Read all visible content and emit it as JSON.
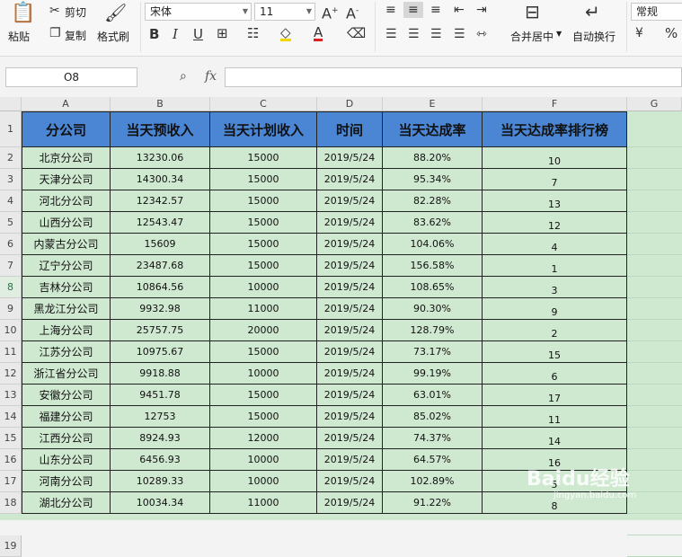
{
  "ribbon": {
    "paste": "粘贴",
    "cut": "剪切",
    "copy": "复制",
    "format_painter": "格式刷",
    "font_name": "宋体",
    "font_size": "11",
    "merge_center": "合并居中",
    "wrap_text": "自动换行",
    "number_format": "常规"
  },
  "formula_bar": {
    "cell_ref": "O8",
    "fx_label": "fx",
    "content": ""
  },
  "columns": [
    "A",
    "B",
    "C",
    "D",
    "E",
    "F",
    "G"
  ],
  "headers": [
    "分公司",
    "当天预收入",
    "当天计划收入",
    "时间",
    "当天达成率",
    "当天达成率排行榜"
  ],
  "rows": [
    [
      "北京分公司",
      "13230.06",
      "15000",
      "2019/5/24",
      "88.20%",
      "10"
    ],
    [
      "天津分公司",
      "14300.34",
      "15000",
      "2019/5/24",
      "95.34%",
      "7"
    ],
    [
      "河北分公司",
      "12342.57",
      "15000",
      "2019/5/24",
      "82.28%",
      "13"
    ],
    [
      "山西分公司",
      "12543.47",
      "15000",
      "2019/5/24",
      "83.62%",
      "12"
    ],
    [
      "内蒙古分公司",
      "15609",
      "15000",
      "2019/5/24",
      "104.06%",
      "4"
    ],
    [
      "辽宁分公司",
      "23487.68",
      "15000",
      "2019/5/24",
      "156.58%",
      "1"
    ],
    [
      "吉林分公司",
      "10864.56",
      "10000",
      "2019/5/24",
      "108.65%",
      "3"
    ],
    [
      "黑龙江分公司",
      "9932.98",
      "11000",
      "2019/5/24",
      "90.30%",
      "9"
    ],
    [
      "上海分公司",
      "25757.75",
      "20000",
      "2019/5/24",
      "128.79%",
      "2"
    ],
    [
      "江苏分公司",
      "10975.67",
      "15000",
      "2019/5/24",
      "73.17%",
      "15"
    ],
    [
      "浙江省分公司",
      "9918.88",
      "10000",
      "2019/5/24",
      "99.19%",
      "6"
    ],
    [
      "安徽分公司",
      "9451.78",
      "15000",
      "2019/5/24",
      "63.01%",
      "17"
    ],
    [
      "福建分公司",
      "12753",
      "15000",
      "2019/5/24",
      "85.02%",
      "11"
    ],
    [
      "江西分公司",
      "8924.93",
      "12000",
      "2019/5/24",
      "74.37%",
      "14"
    ],
    [
      "山东分公司",
      "6456.93",
      "10000",
      "2019/5/24",
      "64.57%",
      "16"
    ],
    [
      "河南分公司",
      "10289.33",
      "10000",
      "2019/5/24",
      "102.89%",
      "5"
    ],
    [
      "湖北分公司",
      "10034.34",
      "11000",
      "2019/5/24",
      "91.22%",
      "8"
    ]
  ],
  "watermark": {
    "text": "Baidu经验",
    "sub": "jingyan.baidu.com"
  },
  "colors": {
    "header_fill": "#4a86d4",
    "sheet_fill": "#cfe8d0"
  }
}
